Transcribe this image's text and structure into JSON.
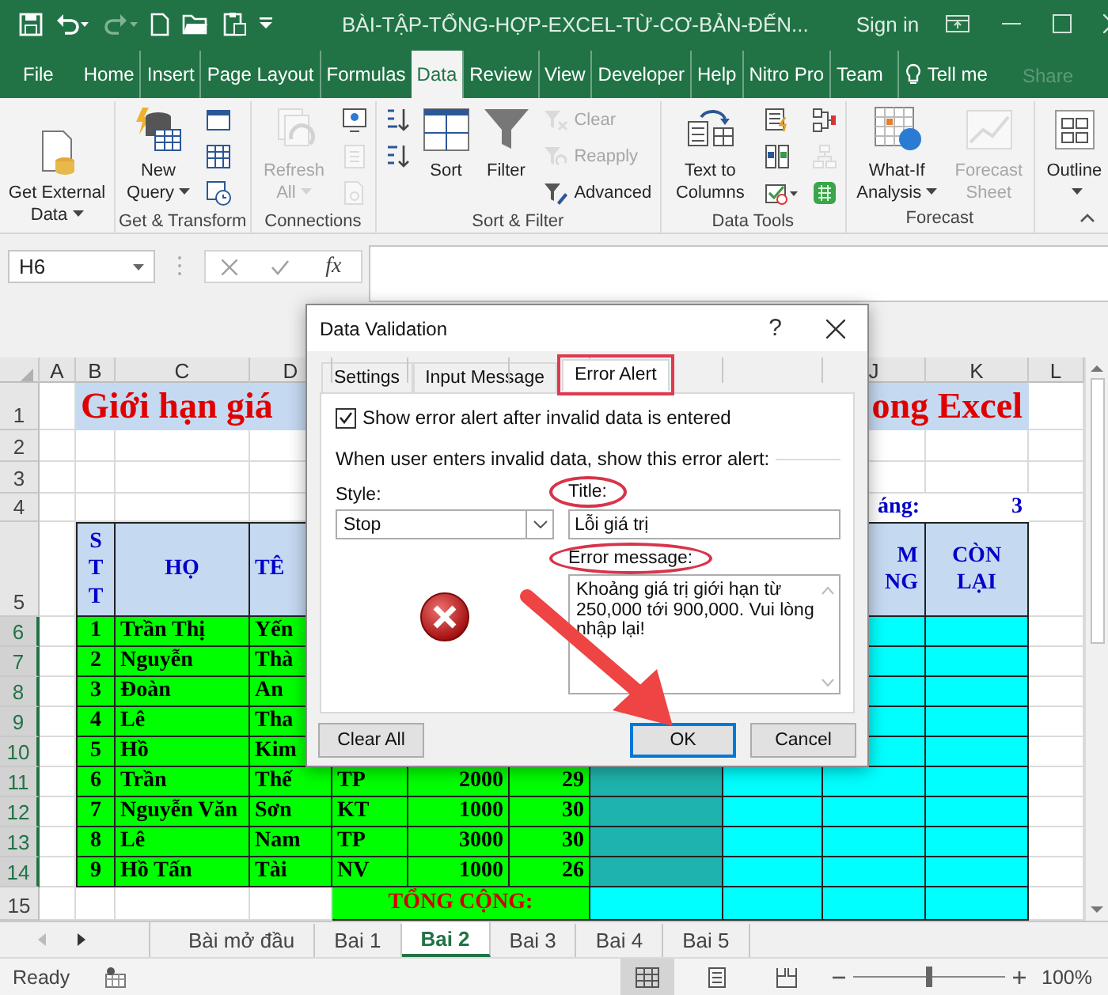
{
  "title_bar": {
    "title": "BÀI-TẬP-TỔNG-HỢP-EXCEL-TỪ-CƠ-BẢN-ĐẾN...",
    "sign_in": "Sign in"
  },
  "ribbon_tabs": [
    {
      "label": "File",
      "selected": false
    },
    {
      "label": "Home",
      "selected": false
    },
    {
      "label": "Insert",
      "selected": false
    },
    {
      "label": "Page Layout",
      "selected": false
    },
    {
      "label": "Formulas",
      "selected": false
    },
    {
      "label": "Data",
      "selected": true
    },
    {
      "label": "Review",
      "selected": false
    },
    {
      "label": "View",
      "selected": false
    },
    {
      "label": "Developer",
      "selected": false
    },
    {
      "label": "Help",
      "selected": false
    },
    {
      "label": "Nitro Pro",
      "selected": false
    },
    {
      "label": "Team",
      "selected": false
    }
  ],
  "tell_me": {
    "label": "Tell me"
  },
  "share": {
    "label": "Share",
    "disabled": true
  },
  "ribbon_groups": [
    {
      "items": [
        {
          "kind": "large",
          "label": "Get External Data",
          "dropdown": true,
          "disabled": false
        }
      ]
    },
    {
      "label": "Get & Transform",
      "items": [
        {
          "kind": "large",
          "label": "New Query",
          "dropdown": true,
          "disabled": false
        },
        {
          "kind": "small",
          "disabled": false
        },
        {
          "kind": "small",
          "disabled": false
        },
        {
          "kind": "small",
          "disabled": false
        }
      ]
    },
    {
      "label": "Connections",
      "items": [
        {
          "kind": "large",
          "label": "Refresh All",
          "dropdown": true,
          "disabled": true
        },
        {
          "kind": "small",
          "disabled": false
        },
        {
          "kind": "small",
          "disabled": true
        },
        {
          "kind": "small",
          "disabled": true
        }
      ]
    },
    {
      "label": "Sort & Filter",
      "items": [
        {
          "kind": "small",
          "disabled": false
        },
        {
          "kind": "small",
          "disabled": false
        },
        {
          "kind": "large",
          "label": "Sort",
          "dropdown": false,
          "disabled": false
        },
        {
          "kind": "large",
          "label": "Filter",
          "dropdown": false,
          "disabled": false
        },
        {
          "kind": "small",
          "label": "Clear",
          "disabled": true
        },
        {
          "kind": "small",
          "label": "Reapply",
          "disabled": true
        },
        {
          "kind": "small",
          "label": "Advanced",
          "disabled": false
        }
      ]
    },
    {
      "label": "Data Tools",
      "items": [
        {
          "kind": "large",
          "label": "Text to Columns",
          "dropdown": false,
          "disabled": false
        },
        {
          "kind": "small",
          "disabled": false
        },
        {
          "kind": "small",
          "disabled": false
        },
        {
          "kind": "small",
          "disabled": false
        },
        {
          "kind": "small",
          "disabled": false
        },
        {
          "kind": "small",
          "disabled": true
        },
        {
          "kind": "small",
          "disabled": false
        }
      ]
    },
    {
      "label": "Forecast",
      "items": [
        {
          "kind": "large",
          "label": "What-If Analysis",
          "dropdown": true,
          "disabled": false
        },
        {
          "kind": "large",
          "label": "Forecast Sheet",
          "dropdown": false,
          "disabled": true
        }
      ]
    },
    {
      "items": [
        {
          "kind": "large",
          "label": "Outline",
          "dropdown": true,
          "disabled": false
        }
      ]
    }
  ],
  "formula_bar": {
    "name_box": "H6",
    "function_button": "fx"
  },
  "columns": [
    {
      "kind": "letter",
      "label": "A"
    },
    {
      "kind": "letter",
      "label": "B"
    },
    {
      "kind": "letter",
      "label": "C"
    },
    {
      "kind": "letter",
      "label": "D"
    },
    {
      "kind": "covered"
    },
    {
      "kind": "covered"
    },
    {
      "kind": "covered"
    },
    {
      "kind": "covered"
    },
    {
      "kind": "covered"
    },
    {
      "kind": "letter",
      "label": "J"
    },
    {
      "kind": "letter",
      "label": "K"
    },
    {
      "kind": "letter",
      "label": "L"
    }
  ],
  "rows": [
    {
      "number": "1",
      "selected": false,
      "cells": [
        {
          "kind": "blank"
        },
        {
          "kind": "title",
          "text": "Giới hạn giá",
          "cut_right": true
        },
        {
          "kind": "merged"
        },
        {
          "kind": "merged"
        },
        {
          "kind": "merged"
        },
        {
          "kind": "title",
          "text": "ong Excel",
          "cut_left": true
        },
        {
          "kind": "merged"
        },
        {
          "kind": "merged"
        },
        {
          "kind": "merged"
        },
        {
          "kind": "merged"
        },
        {
          "kind": "merged"
        }
      ]
    },
    {
      "number": "2",
      "selected": false
    },
    {
      "number": "3",
      "selected": false
    },
    {
      "number": "4",
      "selected": false,
      "cells": [
        {
          "kind": "blank"
        },
        {
          "kind": "blank"
        },
        {
          "kind": "blank"
        },
        {
          "kind": "blank"
        },
        {
          "kind": "blank"
        },
        {
          "kind": "blank"
        },
        {
          "kind": "blank"
        },
        {
          "kind": "blank"
        },
        {
          "kind": "blank"
        },
        {
          "kind": "label",
          "text": "áng:"
        },
        {
          "kind": "label",
          "text": "3"
        }
      ]
    },
    {
      "number": "5",
      "selected": false,
      "cells": [
        {
          "kind": "blank"
        },
        {
          "kind": "vheader",
          "text": "STT"
        },
        {
          "kind": "header",
          "text": "HỌ"
        },
        {
          "kind": "header",
          "text": "TÊ",
          "cut_right": true
        },
        {
          "kind": "blank"
        },
        {
          "kind": "blank"
        },
        {
          "kind": "blank"
        },
        {
          "kind": "blank"
        },
        {
          "kind": "blank"
        },
        {
          "kind": "header",
          "text": "M\nNG",
          "cut_left": true
        },
        {
          "kind": "header",
          "text": "CÒN\nLẠI"
        }
      ]
    },
    {
      "number": "6",
      "selected": true,
      "cells": [
        {
          "kind": "blank"
        },
        {
          "kind": "index",
          "text": "1"
        },
        {
          "kind": "text",
          "text": "Trần Thị"
        },
        {
          "kind": "text",
          "text": "Yến"
        },
        {
          "kind": "blank"
        },
        {
          "kind": "blank"
        },
        {
          "kind": "blank"
        },
        {
          "kind": "blank"
        },
        {
          "kind": "blank"
        },
        {
          "kind": "calc",
          "selected": false
        },
        {
          "kind": "calc",
          "selected": false
        }
      ]
    },
    {
      "number": "7",
      "selected": true,
      "cells": [
        {
          "kind": "blank"
        },
        {
          "kind": "index",
          "text": "2"
        },
        {
          "kind": "text",
          "text": "Nguyễn"
        },
        {
          "kind": "text",
          "text": "Thà"
        },
        {
          "kind": "blank"
        },
        {
          "kind": "blank"
        },
        {
          "kind": "blank"
        },
        {
          "kind": "blank"
        },
        {
          "kind": "blank"
        },
        {
          "kind": "calc",
          "selected": false
        },
        {
          "kind": "calc",
          "selected": false
        }
      ]
    },
    {
      "number": "8",
      "selected": true,
      "cells": [
        {
          "kind": "blank"
        },
        {
          "kind": "index",
          "text": "3"
        },
        {
          "kind": "text",
          "text": "Đoàn"
        },
        {
          "kind": "text",
          "text": "An"
        },
        {
          "kind": "blank"
        },
        {
          "kind": "blank"
        },
        {
          "kind": "blank"
        },
        {
          "kind": "blank"
        },
        {
          "kind": "blank"
        },
        {
          "kind": "calc",
          "selected": false
        },
        {
          "kind": "calc",
          "selected": false
        }
      ]
    },
    {
      "number": "9",
      "selected": true,
      "cells": [
        {
          "kind": "blank"
        },
        {
          "kind": "index",
          "text": "4"
        },
        {
          "kind": "text",
          "text": "Lê"
        },
        {
          "kind": "text",
          "text": "Tha"
        },
        {
          "kind": "blank"
        },
        {
          "kind": "blank"
        },
        {
          "kind": "blank"
        },
        {
          "kind": "blank"
        },
        {
          "kind": "blank"
        },
        {
          "kind": "calc",
          "selected": false
        },
        {
          "kind": "calc",
          "selected": false
        }
      ]
    },
    {
      "number": "10",
      "selected": true,
      "cells": [
        {
          "kind": "blank"
        },
        {
          "kind": "index",
          "text": "5"
        },
        {
          "kind": "text",
          "text": "Hồ"
        },
        {
          "kind": "text",
          "text": "Kim"
        },
        {
          "kind": "blank"
        },
        {
          "kind": "blank"
        },
        {
          "kind": "blank"
        },
        {
          "kind": "blank"
        },
        {
          "kind": "blank"
        },
        {
          "kind": "calc",
          "selected": false
        },
        {
          "kind": "calc",
          "selected": false
        }
      ]
    },
    {
      "number": "11",
      "selected": true,
      "cells": [
        {
          "kind": "blank"
        },
        {
          "kind": "index",
          "text": "6"
        },
        {
          "kind": "text",
          "text": "Trần"
        },
        {
          "kind": "text",
          "text": "Thế"
        },
        {
          "kind": "text",
          "text": "TP"
        },
        {
          "kind": "number",
          "text": "2000"
        },
        {
          "kind": "number",
          "text": "29"
        },
        {
          "kind": "calc",
          "selected": true
        },
        {
          "kind": "calc",
          "selected": false
        },
        {
          "kind": "calc",
          "selected": false
        },
        {
          "kind": "calc",
          "selected": false
        }
      ]
    },
    {
      "number": "12",
      "selected": true,
      "cells": [
        {
          "kind": "blank"
        },
        {
          "kind": "index",
          "text": "7"
        },
        {
          "kind": "text",
          "text": "Nguyễn Văn"
        },
        {
          "kind": "text",
          "text": "Sơn"
        },
        {
          "kind": "text",
          "text": "KT"
        },
        {
          "kind": "number",
          "text": "1000"
        },
        {
          "kind": "number",
          "text": "30"
        },
        {
          "kind": "calc",
          "selected": true
        },
        {
          "kind": "calc",
          "selected": false
        },
        {
          "kind": "calc",
          "selected": false
        },
        {
          "kind": "calc",
          "selected": false
        }
      ]
    },
    {
      "number": "13",
      "selected": true,
      "cells": [
        {
          "kind": "blank"
        },
        {
          "kind": "index",
          "text": "8"
        },
        {
          "kind": "text",
          "text": "Lê"
        },
        {
          "kind": "text",
          "text": "Nam"
        },
        {
          "kind": "text",
          "text": "TP"
        },
        {
          "kind": "number",
          "text": "3000"
        },
        {
          "kind": "number",
          "text": "30"
        },
        {
          "kind": "calc",
          "selected": true
        },
        {
          "kind": "calc",
          "selected": false
        },
        {
          "kind": "calc",
          "selected": false
        },
        {
          "kind": "calc",
          "selected": false
        }
      ]
    },
    {
      "number": "14",
      "selected": true,
      "cells": [
        {
          "kind": "blank"
        },
        {
          "kind": "index",
          "text": "9"
        },
        {
          "kind": "text",
          "text": "Hồ Tấn"
        },
        {
          "kind": "text",
          "text": "Tài"
        },
        {
          "kind": "text",
          "text": "NV"
        },
        {
          "kind": "number",
          "text": "1000"
        },
        {
          "kind": "number",
          "text": "26"
        },
        {
          "kind": "calc",
          "selected": true
        },
        {
          "kind": "calc",
          "selected": false
        },
        {
          "kind": "calc",
          "selected": false
        },
        {
          "kind": "calc",
          "selected": false
        }
      ]
    },
    {
      "number": "15",
      "selected": false,
      "cells": [
        {
          "kind": "blank"
        },
        {
          "kind": "blank"
        },
        {
          "kind": "blank"
        },
        {
          "kind": "blank"
        },
        {
          "kind": "total",
          "text": "TỔNG CỘNG:"
        },
        {
          "kind": "merged"
        },
        {
          "kind": "merged"
        },
        {
          "kind": "calc",
          "selected": false
        },
        {
          "kind": "calc",
          "selected": false
        },
        {
          "kind": "calc",
          "selected": false
        },
        {
          "kind": "calc",
          "selected": false
        }
      ]
    }
  ],
  "dialog": {
    "title": "Data Validation",
    "help": "?",
    "tabs": [
      {
        "label": "Settings",
        "selected": false,
        "highlighted": false
      },
      {
        "label": "Input Message",
        "selected": false,
        "highlighted": false
      },
      {
        "label": "Error Alert",
        "selected": true,
        "highlighted": true
      }
    ],
    "show_alert": {
      "label": "Show error alert after invalid data is entered",
      "checked": true
    },
    "group_label": "When user enters invalid data, show this error alert:",
    "style": {
      "label": "Style:",
      "value": "Stop"
    },
    "title_field": {
      "label": "Title:",
      "value": "Lỗi giá trị",
      "highlighted": true
    },
    "message_field": {
      "label": "Error message:",
      "value": "Khoảng giá trị giới hạn từ 250,000 tới 900,000. Vui lòng nhập lại!",
      "highlighted": true
    },
    "buttons": [
      {
        "label": "Clear All",
        "default": false
      },
      {
        "label": "OK",
        "default": true
      },
      {
        "label": "Cancel",
        "default": false
      }
    ],
    "callouts": [
      {
        "kind": "arrow"
      }
    ]
  },
  "sheet_tabs": [
    {
      "label": "Bài mở đầu",
      "selected": false
    },
    {
      "label": "Bai 1",
      "selected": false
    },
    {
      "label": "Bai 2",
      "selected": true
    },
    {
      "label": "Bai 3",
      "selected": false
    },
    {
      "label": "Bai 4",
      "selected": false
    },
    {
      "label": "Bai 5",
      "selected": false
    }
  ],
  "status_bar": {
    "status": "Ready",
    "views": [
      {
        "selected": true
      },
      {
        "selected": false
      },
      {
        "selected": false
      }
    ],
    "zoom_slider": {
      "level": 0.5
    },
    "zoom": "100%"
  }
}
